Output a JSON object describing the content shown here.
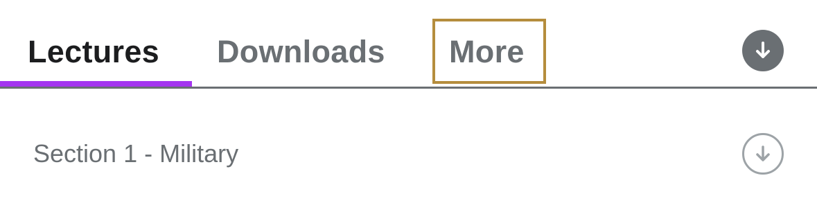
{
  "tabs": {
    "lectures": "Lectures",
    "downloads": "Downloads",
    "more": "More",
    "active": "lectures"
  },
  "header": {
    "download_all_icon": "download-arrow-icon"
  },
  "sections": [
    {
      "title": "Section 1 - Military",
      "download_icon": "download-arrow-outline-icon"
    }
  ],
  "colors": {
    "accent": "#a435f0",
    "highlight_box": "#b58d3d",
    "active_tab_text": "#1c1d1f",
    "inactive_tab_text": "#6a6f73"
  }
}
